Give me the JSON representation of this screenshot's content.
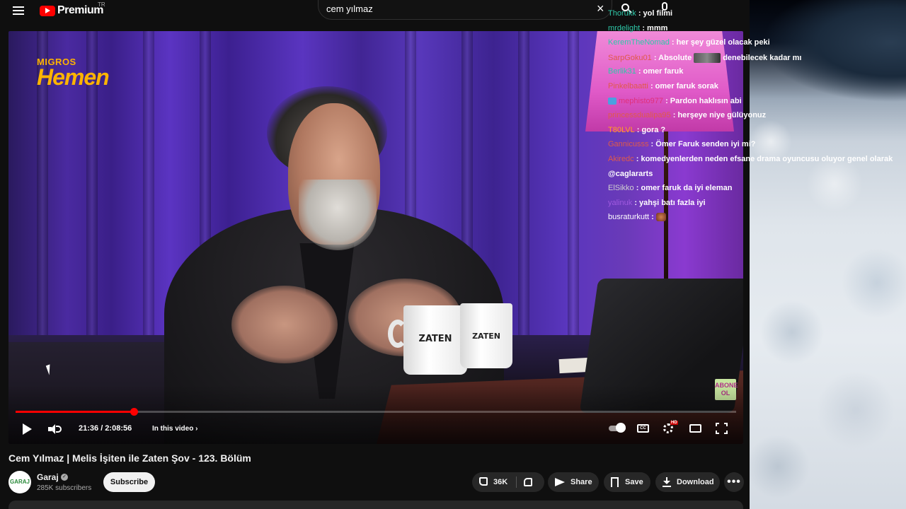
{
  "masthead": {
    "logo_text": "Premium",
    "country_code": "TR",
    "search_query": "cem yılmaz"
  },
  "player": {
    "brand_small": "MIGROS",
    "brand_big": "Hemen",
    "mug_label_1": "ZATEN",
    "mug_label_2": "ZATEN",
    "watermark_line1": "ABONE",
    "watermark_line2": "OL",
    "progress_fraction": 0.164,
    "time_display": "21:36 / 2:08:56",
    "chapters_label": "In this video",
    "chapters_chevron": "›",
    "cc_label": "CC",
    "hd_badge": "HD"
  },
  "chat": {
    "messages": [
      {
        "user": "Thorukk",
        "user_color": "#2ec8a8",
        "text": ": yol filmi"
      },
      {
        "user": "mrdelight",
        "user_color": "#2ec8a8",
        "text": ": mmm"
      },
      {
        "user": "KeremTheNomad",
        "user_color": "#2ec8a8",
        "text": ": her şey güzel olacak peki"
      },
      {
        "user": "SarpGoku01",
        "user_color": "#e05a4a",
        "text": ": Absolute",
        "emote_image": true,
        "text_after": "denebilecek kadar mı"
      },
      {
        "user": "Berlik31",
        "user_color": "#2ec8a8",
        "text": ": omer faruk"
      },
      {
        "user": "Pinkelbaatti",
        "user_color": "#e05a4a",
        "text": ": omer faruk sorak"
      },
      {
        "user": "mephisto977",
        "user_color": "#e0307a",
        "text": ": Pardon haklısın abi",
        "badge": true
      },
      {
        "user": "princessdualipa95",
        "user_color": "#e05a4a",
        "text": ": herşeye niye gülüyonuz"
      },
      {
        "user": "T80LVL",
        "user_color": "#ffa020",
        "text": ": gora ?"
      },
      {
        "user": "Gannicusss",
        "user_color": "#e05a4a",
        "text": ": Ömer Faruk senden iyi mi?"
      },
      {
        "user": "Akiredc",
        "user_color": "#e05a4a",
        "text": ": komedyenlerden neden efsane drama oyuncusu oluyor genel olarak"
      },
      {
        "user": "",
        "user_color": "#ffffff",
        "text": "@caglararts"
      },
      {
        "user": "ElSikko",
        "user_color": "#d0d0d0",
        "text": ": omer faruk da iyi eleman"
      },
      {
        "user": "yalinuk",
        "user_color": "#a05ae0",
        "text": ": yahşi batı fazla iyi"
      },
      {
        "user": "busraturkutt",
        "user_color": "#ffffff",
        "text": ":",
        "emote_food": true
      }
    ]
  },
  "video": {
    "title": "Cem Yılmaz | Melis İşiten ile Zaten Şov - 123. Bölüm",
    "channel_name": "Garaj",
    "channel_avatar_text": "GARAJ",
    "verified_glyph": "✓",
    "subscriber_count": "285K subscribers",
    "subscribe_label": "Subscribe",
    "like_count": "36K",
    "share_label": "Share",
    "save_label": "Save",
    "download_label": "Download",
    "more_glyph": "•••"
  }
}
